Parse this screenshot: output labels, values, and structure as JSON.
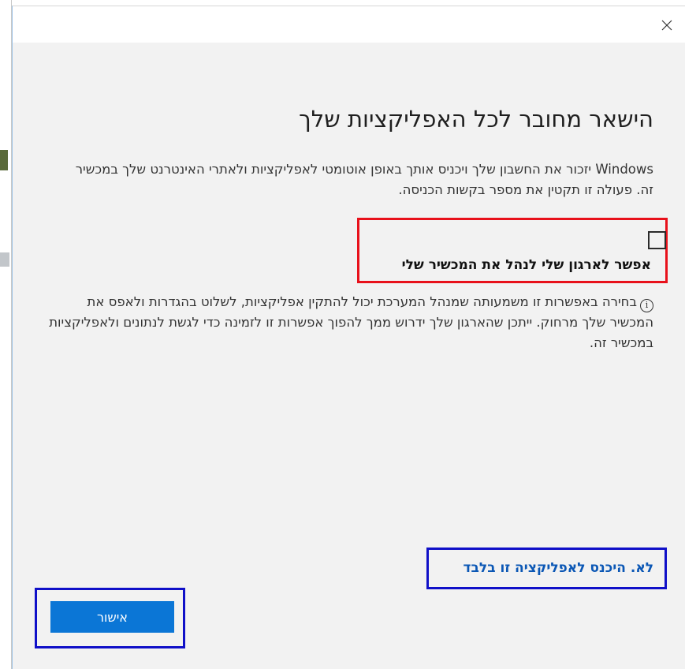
{
  "dialog": {
    "close_glyph": "×",
    "title": "הישאר מחובר לכל האפליקציות שלך",
    "description": "Windows יזכור את החשבון שלך ויכניס אותך באופן אוטומטי לאפליקציות ולאתרי האינטרנט שלך במכשיר זה. פעולה זו תקטין את מספר בקשות הכניסה.",
    "checkbox": {
      "checked": false,
      "label": "אפשר לארגון שלי לנהל את המכשיר שלי"
    },
    "info_icon_glyph": "i",
    "info_text": "בחירה באפשרות זו משמעותה שמנהל המערכת יכול להתקין אפליקציות, לשלוט בהגדרות ולאפס את המכשיר שלך מרחוק. ייתכן שהארגון שלך ידרוש ממך להפוך אפשרות זו לזמינה כדי לגשת לנתונים ולאפליקציות במכשיר זה.",
    "skip_link": "לא. היכנס לאפליקציה זו בלבד",
    "ok_button": "אישור"
  },
  "colors": {
    "dialog_background": "#f2f2f2",
    "titlebar_background": "#ffffff",
    "primary_button": "#0b76d6",
    "link": "#0b57b5",
    "annotation_red": "#e8111b",
    "annotation_blue": "#1010c8"
  },
  "icons": {
    "close": "close-icon",
    "info": "info-icon",
    "checkbox": "checkbox-unchecked"
  }
}
